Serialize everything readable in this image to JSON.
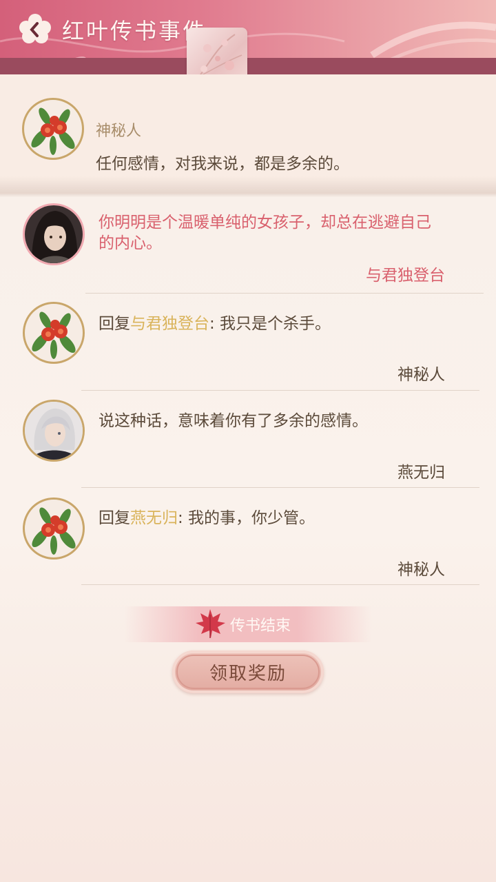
{
  "header": {
    "title": "红叶传书事件",
    "back_icon": "back-icon"
  },
  "post": {
    "author": "神秘人",
    "text": "任何感情，对我来说，都是多余的。"
  },
  "comments": [
    {
      "text_line1": "你明明是个温暖单纯的女孩子，却总在逃避自己",
      "text_line2": "的内心。",
      "signature": "与君独登台",
      "highlight": true
    },
    {
      "prefix": "回复",
      "mention": "与君独登台",
      "body": ": 我只是个杀手。",
      "signature": "神秘人"
    },
    {
      "text": "说这种话，意味着你有了多余的感情。",
      "signature": "燕无归"
    },
    {
      "prefix": "回复",
      "mention": "燕无归",
      "body": ": 我的事，你少管。",
      "signature": "神秘人"
    }
  ],
  "footer": {
    "end_label": "传书结束",
    "reward_button": "领取奖励"
  },
  "colors": {
    "header_pink": "#d4607a",
    "highlight_text": "#d9606d",
    "mention_gold": "#d9b35a",
    "avatar_border": "#c9a66a"
  }
}
